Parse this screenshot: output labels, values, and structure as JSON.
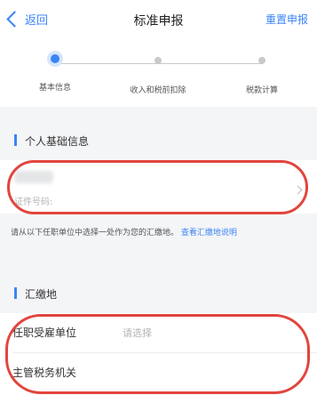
{
  "nav": {
    "back_label": "返回",
    "title": "标准申报",
    "right_label": "重置申报"
  },
  "steps": [
    {
      "label": "基本信息",
      "active": true
    },
    {
      "label": "收入和税前扣除",
      "active": false
    },
    {
      "label": "税款计算",
      "active": false
    }
  ],
  "personal_section": {
    "title": "个人基础信息",
    "cert_label": "证件号码:"
  },
  "notice": {
    "text": "请从以下任职单位中选择一处作为您的汇缴地。",
    "link": "查看汇缴地说明"
  },
  "filing_section": {
    "title": "汇缴地",
    "rows": [
      {
        "label": "任职受雇单位",
        "value": "请选择"
      },
      {
        "label": "主管税务机关",
        "value": ""
      }
    ]
  },
  "colors": {
    "accent": "#3b84f6",
    "annotation": "#e2453e",
    "background": "#f4f5f7"
  }
}
